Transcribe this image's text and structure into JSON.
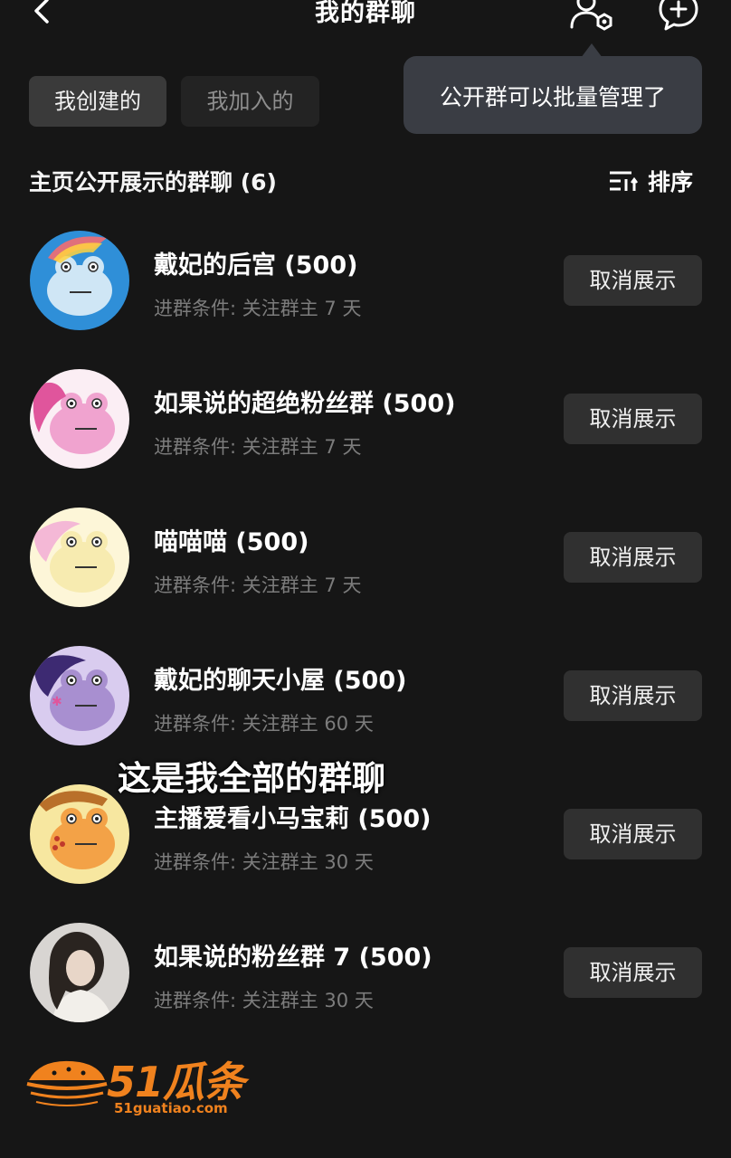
{
  "header": {
    "title": "我的群聊",
    "back_icon": "chevron-left-icon",
    "manage_icon": "group-settings-icon",
    "new_chat_icon": "chat-plus-icon"
  },
  "tabs": [
    {
      "label": "我创建的",
      "active": true
    },
    {
      "label": "我加入的",
      "active": false
    }
  ],
  "tooltip": {
    "text": "公开群可以批量管理了"
  },
  "section": {
    "title": "主页公开展示的群聊 (6)",
    "sort_label": "排序",
    "sort_icon": "sort-icon"
  },
  "groups": [
    {
      "name": "戴妃的后宫 (500)",
      "condition": "进群条件: 关注群主 7 天",
      "action": "取消展示",
      "avatar_color": "#2f8fd8"
    },
    {
      "name": "如果说的超绝粉丝群 (500)",
      "condition": "进群条件: 关注群主 7 天",
      "action": "取消展示",
      "avatar_color": "#f0a3cf"
    },
    {
      "name": "喵喵喵 (500)",
      "condition": "进群条件: 关注群主 7 天",
      "action": "取消展示",
      "avatar_color": "#f7ebb0"
    },
    {
      "name": "戴妃的聊天小屋 (500)",
      "condition": "进群条件: 关注群主 60 天",
      "action": "取消展示",
      "avatar_color": "#a88fd0"
    },
    {
      "name": "主播爱看小马宝莉 (500)",
      "condition": "进群条件: 关注群主 30 天",
      "action": "取消展示",
      "avatar_color": "#f3a247"
    },
    {
      "name": "如果说的粉丝群 7 (500)",
      "condition": "进群条件: 关注群主 30 天",
      "action": "取消展示",
      "avatar_color": "#d8d5d2"
    }
  ],
  "caption": "这是我全部的群聊",
  "watermark": {
    "brand": "51瓜条",
    "url": "51guatiao.com"
  },
  "colors": {
    "background": "#161616",
    "button": "#303030",
    "tooltip": "#3a3d44",
    "watermark": "#f0821e"
  }
}
